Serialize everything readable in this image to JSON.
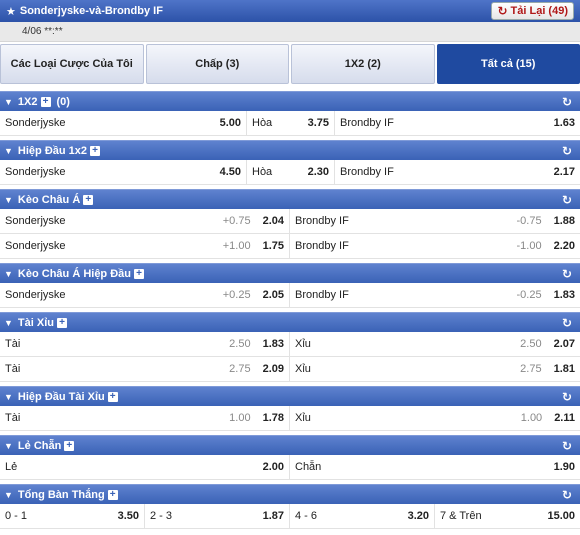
{
  "header": {
    "title": "Sonderjyske-và-Brondby IF",
    "reload_label": "Tải Lại (49)"
  },
  "date": "4/06 **:**",
  "tabs": [
    {
      "label": "Các Loại Cược Của Tôi"
    },
    {
      "label": "Chấp (3)"
    },
    {
      "label": "1X2 (2)"
    },
    {
      "label": "Tất cả (15)"
    }
  ],
  "sections": {
    "s1x2": {
      "title": "1X2",
      "count": "(0)",
      "rows": [
        {
          "home": "Sonderjyske",
          "home_odds": "5.00",
          "draw": "Hòa",
          "draw_odds": "3.75",
          "away": "Brondby IF",
          "away_odds": "1.63"
        }
      ]
    },
    "sht1x2": {
      "title": "Hiệp Đầu 1x2",
      "rows": [
        {
          "home": "Sonderjyske",
          "home_odds": "4.50",
          "draw": "Hòa",
          "draw_odds": "2.30",
          "away": "Brondby IF",
          "away_odds": "2.17"
        }
      ]
    },
    "sah": {
      "title": "Kèo Châu Á",
      "rows": [
        {
          "home": "Sonderjyske",
          "home_hcp": "+0.75",
          "home_odds": "2.04",
          "away": "Brondby IF",
          "away_hcp": "-0.75",
          "away_odds": "1.88"
        },
        {
          "home": "Sonderjyske",
          "home_hcp": "+1.00",
          "home_odds": "1.75",
          "away": "Brondby IF",
          "away_hcp": "-1.00",
          "away_odds": "2.20"
        }
      ]
    },
    "sahht": {
      "title": "Kèo Châu Á Hiệp Đầu",
      "rows": [
        {
          "home": "Sonderjyske",
          "home_hcp": "+0.25",
          "home_odds": "2.05",
          "away": "Brondby IF",
          "away_hcp": "-0.25",
          "away_odds": "1.83"
        }
      ]
    },
    "sou": {
      "title": "Tài Xỉu",
      "rows": [
        {
          "home": "Tài",
          "home_hcp": "2.50",
          "home_odds": "1.83",
          "away": "Xỉu",
          "away_hcp": "2.50",
          "away_odds": "2.07"
        },
        {
          "home": "Tài",
          "home_hcp": "2.75",
          "home_odds": "2.09",
          "away": "Xỉu",
          "away_hcp": "2.75",
          "away_odds": "1.81"
        }
      ]
    },
    "souht": {
      "title": "Hiệp Đầu Tài Xỉu",
      "rows": [
        {
          "home": "Tài",
          "home_hcp": "1.00",
          "home_odds": "1.78",
          "away": "Xỉu",
          "away_hcp": "1.00",
          "away_odds": "2.11"
        }
      ]
    },
    "soe": {
      "title": "Lẻ Chẵn",
      "rows": [
        {
          "home": "Lẻ",
          "home_odds": "2.00",
          "away": "Chẵn",
          "away_odds": "1.90"
        }
      ]
    },
    "stg": {
      "title": "Tổng Bàn Thắng",
      "rows": [
        {
          "c1": "0 - 1",
          "o1": "3.50",
          "c2": "2 - 3",
          "o2": "1.87",
          "c3": "4 - 6",
          "o3": "3.20",
          "c4": "7 & Trên",
          "o4": "15.00"
        }
      ]
    }
  }
}
